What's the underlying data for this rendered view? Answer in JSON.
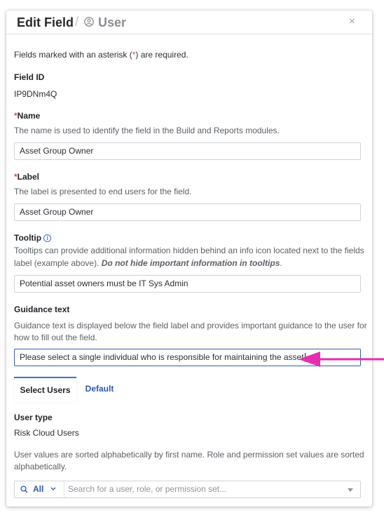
{
  "header": {
    "title": "Edit Field",
    "separator": "/",
    "subtitle": "User",
    "close": "×"
  },
  "form": {
    "required_note_pre": "Fields marked with an asterisk (",
    "required_star": "*",
    "required_note_post": ") are required.",
    "field_id_label": "Field ID",
    "field_id_value": "IP9DNm4Q",
    "name": {
      "star": "*",
      "label": "Name",
      "help": "The name is used to identify the field in the Build and Reports modules.",
      "value": "Asset Group Owner"
    },
    "label": {
      "star": "*",
      "label": "Label",
      "help": "The label is presented to end users for the field.",
      "value": "Asset Group Owner"
    },
    "tooltip": {
      "label": "Tooltip",
      "help_line1": "Tooltips can provide additional information hidden behind an info icon located next to the fields",
      "help_line2_pre": "label (example above). ",
      "help_line2_emph": "Do not hide important information in tooltips",
      "help_line2_post": ".",
      "value": "Potential asset owners must be IT Sys Admin"
    },
    "guidance": {
      "label": "Guidance text",
      "help_line1": "Guidance text is displayed below the field label and provides important guidance to the user for",
      "help_line2": "how to fill out the field.",
      "value": "Please select a single individual who is responsible for maintaining the asset"
    }
  },
  "tabs": [
    {
      "label": "Select Users",
      "selected": true
    },
    {
      "label": "Default",
      "selected": false
    }
  ],
  "select_users": {
    "user_type_label": "User type",
    "user_type_value": "Risk Cloud Users",
    "sort_note_line1": "User values are sorted alphabetically by first name. Role and permission set values are sorted",
    "sort_note_line2": "alphabetically.",
    "search": {
      "filter_label": "All",
      "placeholder": "Search for a user, role, or permission set..."
    }
  },
  "colors": {
    "accent": "#3b6fd4",
    "required": "#e5484d",
    "annotation_arrow": "#e62eb0"
  },
  "icons": [
    "user-circle-icon",
    "close-icon",
    "info-icon",
    "search-icon",
    "chevron-down-icon",
    "dropdown-arrow-icon",
    "pink-arrow-icon"
  ]
}
